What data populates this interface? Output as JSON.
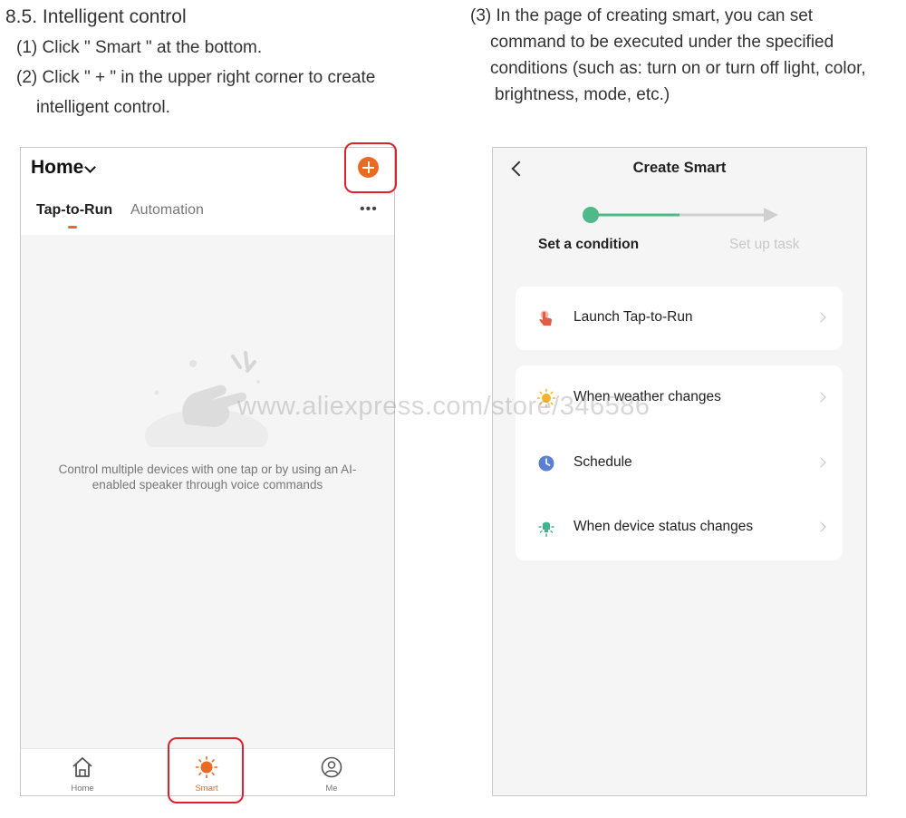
{
  "instructions": {
    "heading": "8.5. Intelligent control",
    "step1": "(1) Click \" Smart \" at the bottom.",
    "step2_line1": "(2) Click \" + \" in the upper right corner to create",
    "step2_line2": "intelligent control.",
    "step3_line1": "(3) In the page of creating smart, you can set",
    "step3_line2": "command to be executed under the specified",
    "step3_line3": "conditions (such as: turn on or turn off light, color,",
    "step3_line4": "brightness, mode, etc.)"
  },
  "smart_page": {
    "home_title": "Home",
    "tabs": [
      "Tap-to-Run",
      "Automation"
    ],
    "more_label": "•••",
    "empty_line1": "Control multiple devices with one tap or by using an AI-",
    "empty_line2": "enabled speaker through voice commands",
    "tabbar": [
      {
        "label": "Home",
        "icon": "home-icon"
      },
      {
        "label": "Smart",
        "icon": "sun-icon"
      },
      {
        "label": "Me",
        "icon": "user-icon"
      }
    ],
    "accent_color": "#ea6a24",
    "highlight_color": "#e0202a"
  },
  "create_smart": {
    "title": "Create Smart",
    "steps": [
      "Set a condition",
      "Set up task"
    ],
    "progress_color": "#4fb98a",
    "options": [
      {
        "label": "Launch Tap-to-Run",
        "icon": "hand-tap-icon"
      },
      {
        "label": "When weather changes",
        "icon": "sun-icon"
      },
      {
        "label": "Schedule",
        "icon": "clock-icon"
      },
      {
        "label": "When device status changes",
        "icon": "device-icon"
      }
    ]
  },
  "watermark": "www.aliexpress.com/store/346586"
}
